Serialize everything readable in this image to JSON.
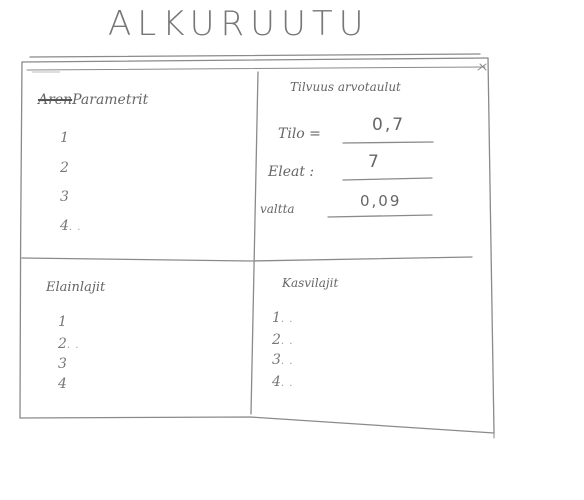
{
  "title": "ALKURUUTU",
  "window": {
    "close_glyph": "x"
  },
  "panels": {
    "top_left": {
      "struck_text": "Aren",
      "title": "Parametrit",
      "items": [
        "1",
        "2",
        "3",
        "4"
      ]
    },
    "top_right": {
      "title": "Tilvuus arvotaulut",
      "params": [
        {
          "label": "Tilo =",
          "value": "0,7"
        },
        {
          "label": "Eleat :",
          "value": "7"
        },
        {
          "label": "valtta",
          "value": "0,09"
        }
      ]
    },
    "bottom_left": {
      "title": "Elainlajit",
      "items": [
        "1",
        "2",
        "3",
        "4"
      ]
    },
    "bottom_right": {
      "title": "Kasvilajit",
      "items": [
        "1",
        "2",
        "3",
        "4"
      ]
    }
  },
  "ellipsis": ". ."
}
